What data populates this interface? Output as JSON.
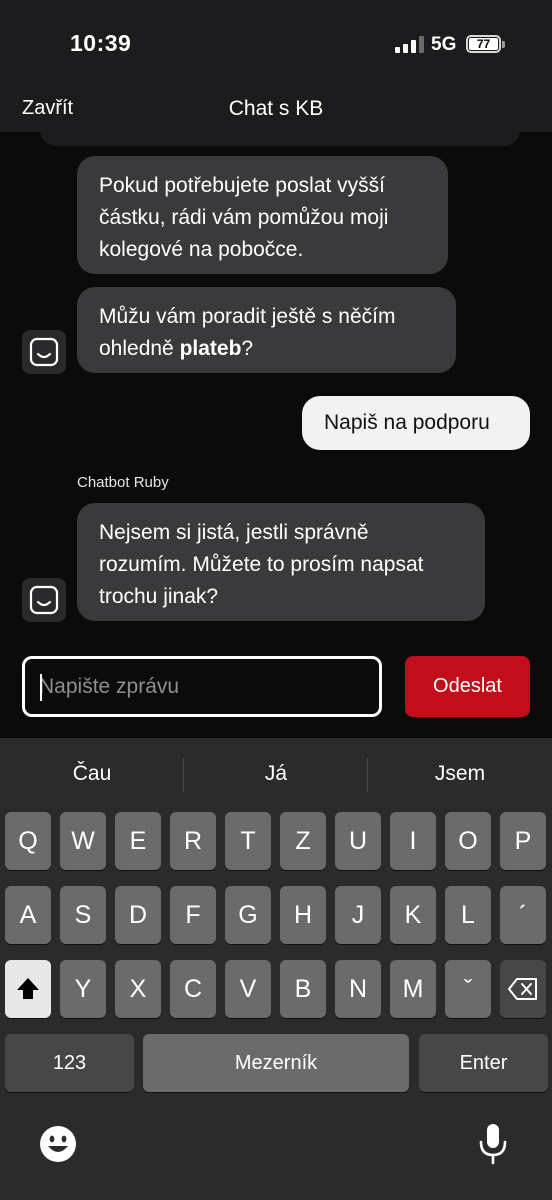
{
  "status": {
    "time": "10:39",
    "network": "5G",
    "battery": "77"
  },
  "header": {
    "close_label": "Zavřít",
    "title": "Chat s KB"
  },
  "chat": {
    "messages": [
      {
        "from": "bot",
        "lines": [
          "Pokud potřebujete poslat vyšší",
          "částku, rádi vám pomůžou moji",
          "kolegové na pobočce."
        ]
      },
      {
        "from": "bot",
        "line1": "Můžu vám poradit ještě s něčím",
        "line2_prefix": "ohledně ",
        "line2_bold": "plateb",
        "line2_suffix": "?"
      },
      {
        "from": "user",
        "text": "Napiš na podporu"
      },
      {
        "from": "bot",
        "sender": "Chatbot Ruby",
        "lines": [
          "Nejsem si jistá, jestli správně",
          "rozumím. Můžete to prosím napsat",
          "trochu jinak?"
        ]
      }
    ]
  },
  "composer": {
    "placeholder": "Napište zprávu",
    "send_label": "Odeslat"
  },
  "keyboard": {
    "suggestions": [
      "Čau",
      "Já",
      "Jsem"
    ],
    "row1": [
      "Q",
      "W",
      "E",
      "R",
      "T",
      "Z",
      "U",
      "I",
      "O",
      "P"
    ],
    "row2": [
      "A",
      "S",
      "D",
      "F",
      "G",
      "H",
      "J",
      "K",
      "L",
      "´"
    ],
    "row3": [
      "Y",
      "X",
      "C",
      "V",
      "B",
      "N",
      "M",
      "ˇ"
    ],
    "numbers_label": "123",
    "space_label": "Mezerník",
    "enter_label": "Enter",
    "icons": {
      "shift": "shift-icon",
      "backspace": "backspace-icon",
      "emoji": "emoji-icon",
      "mic": "microphone-icon"
    }
  },
  "colors": {
    "accent": "#c20e1a",
    "bot_bubble": "#3a3a3c",
    "user_bubble": "#f2f2f2",
    "background": "#0b0b0b"
  }
}
